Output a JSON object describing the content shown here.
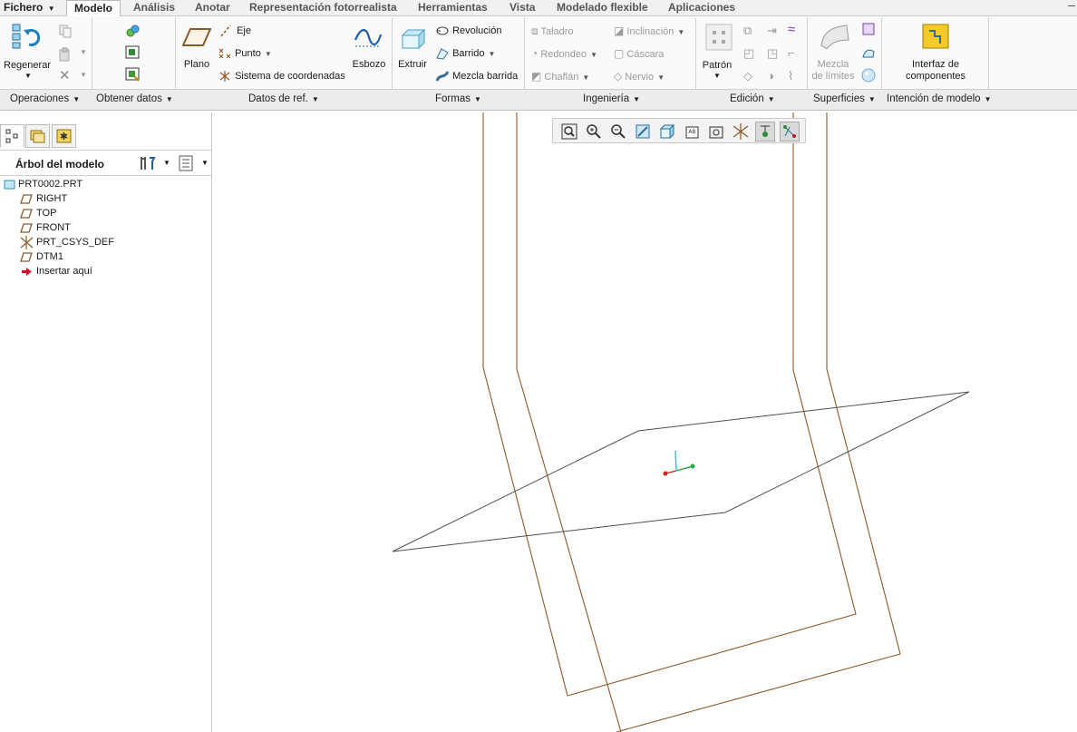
{
  "menu": {
    "file": "Fichero",
    "tabs": [
      "Modelo",
      "Análisis",
      "Anotar",
      "Representación fotorrealista",
      "Herramientas",
      "Vista",
      "Modelado flexible",
      "Aplicaciones"
    ],
    "active_tab": "Modelo"
  },
  "ribbon": {
    "operaciones": {
      "regenerate": "Regenerar"
    },
    "datos_ref": {
      "plane": "Plano",
      "axis": "Eje",
      "point": "Punto",
      "csys": "Sistema de coordenadas",
      "sketch": "Esbozo"
    },
    "formas": {
      "extrude": "Extruir",
      "revolve": "Revolución",
      "sweep": "Barrido",
      "swept_blend": "Mezcla barrida"
    },
    "ingenieria": {
      "hole": "Taladro",
      "round": "Redondeo",
      "chamfer": "Chaflán",
      "draft": "Inclinación",
      "shell": "Cáscara",
      "rib": "Nervio"
    },
    "edicion": {
      "pattern": "Patrón"
    },
    "superficies": {
      "boundary_blend_1": "Mezcla",
      "boundary_blend_2": "de límites"
    },
    "intencion": {
      "component_interface_1": "Interfaz de",
      "component_interface_2": "componentes"
    }
  },
  "groups": [
    "Operaciones",
    "Obtener datos",
    "Datos de ref.",
    "Formas",
    "Ingeniería",
    "Edición",
    "Superficies",
    "Intención de modelo"
  ],
  "model_tree": {
    "title": "Árbol del modelo",
    "root": "PRT0002.PRT",
    "items": [
      "RIGHT",
      "TOP",
      "FRONT",
      "PRT_CSYS_DEF",
      "DTM1",
      "Insertar aquí"
    ]
  },
  "colors": {
    "datum_plane": "#8a5a2b",
    "sketch_plane": "#555555",
    "accent": "#1e7fb8",
    "insert_arrow": "#c8102e"
  }
}
